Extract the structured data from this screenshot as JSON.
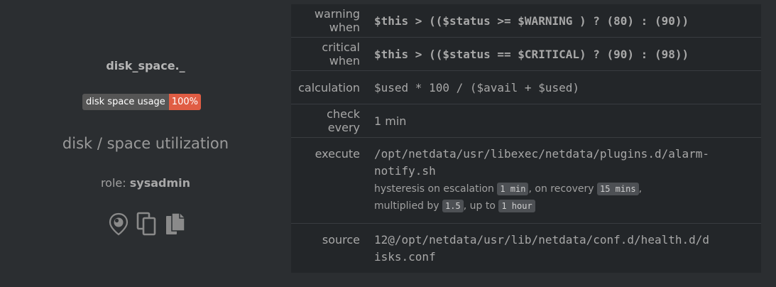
{
  "alarm": {
    "name": "disk_space._",
    "badge_label": "disk space usage",
    "badge_value": "100%",
    "chart_title": "disk / space utilization",
    "role_label": "role:",
    "role_value": "sysadmin",
    "icons": [
      "map-pin-icon",
      "copy-icon",
      "copy-filled-icon"
    ]
  },
  "rows": {
    "warn": {
      "key": "warning when",
      "value": "$this > (($status >= $WARNING ) ? (80) : (90))"
    },
    "crit": {
      "key": "critical when",
      "value": "$this > (($status == $CRITICAL) ? (90) : (98))"
    },
    "calc": {
      "key": "calculation",
      "value": "$used * 100 / ($avail + $used)"
    },
    "every": {
      "key": "check every",
      "value": "1 min"
    },
    "exec": {
      "key": "execute",
      "value_line1": "/opt/netdata/usr/libexec/netdata/plugins.d/alarm-",
      "value_line2": "notify.sh",
      "hyst_text": "hysteresis on escalation",
      "hyst_escalation": "1 min",
      "recovery_text": ", on recovery",
      "hyst_recovery": "15 mins",
      "mult_text": "multiplied by",
      "multiplier": "1.5",
      "upto_text": ", up to",
      "max": "1 hour"
    },
    "source": {
      "key": "source",
      "value_line1": "12@/opt/netdata/usr/lib/netdata/conf.d/health.d/d",
      "value_line2": "isks.conf"
    }
  },
  "colors": {
    "background": "#2b2e31",
    "table_bg": "#232629",
    "highlight": "#ee6b3a",
    "badge_value_bg": "#e05d44"
  }
}
